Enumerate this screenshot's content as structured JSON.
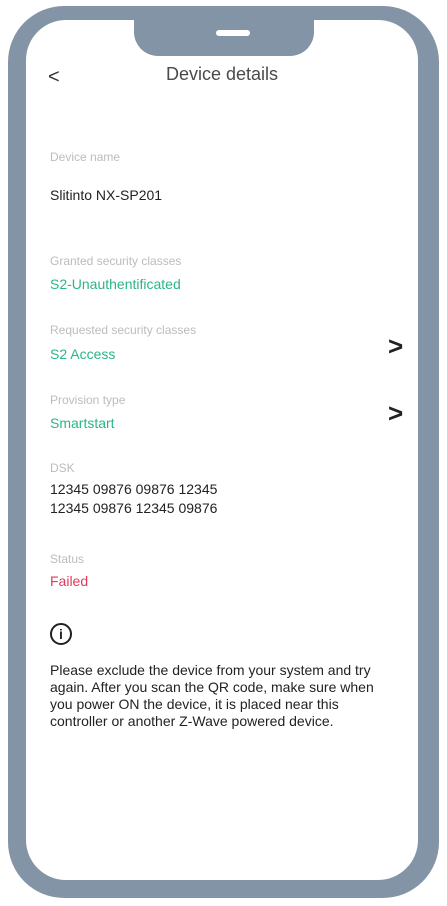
{
  "header": {
    "back_icon": "chevron-left-icon",
    "back_label": "<",
    "title": "Device details"
  },
  "device_name": {
    "label": "Device name",
    "value": "Slitinto NX-SP201"
  },
  "granted_security": {
    "label": "Granted security classes",
    "value": "S2-Unauthentificated"
  },
  "requested_security": {
    "label": "Requested security classes",
    "value": "S2 Access"
  },
  "provision_type": {
    "label": "Provision type",
    "value": "Smartstart"
  },
  "dsk": {
    "label": "DSK",
    "line1": "12345 09876 09876 12345",
    "line2": "12345 09876 12345 09876"
  },
  "status": {
    "label": "Status",
    "value": "Failed"
  },
  "info": {
    "icon": "info-icon",
    "symbol": "i",
    "message": "Please exclude the device from your system and try again. After you scan the QR code, make sure when you power ON the device, it is placed near this controller or another Z-Wave powered device."
  },
  "chevron_symbol": ">",
  "colors": {
    "frame": "#8494a7",
    "success": "#2ab589",
    "error": "#e23a5a"
  }
}
